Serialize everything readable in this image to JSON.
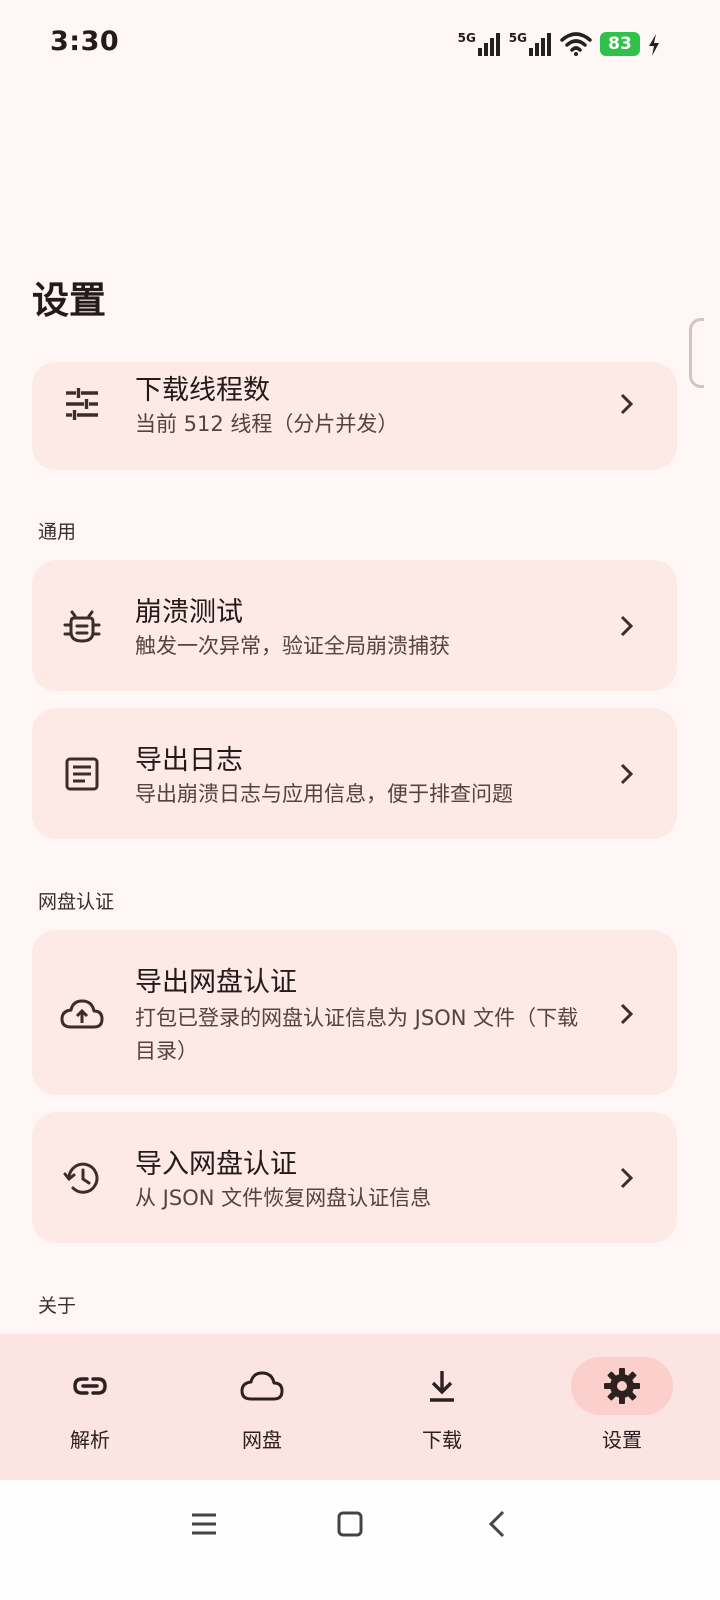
{
  "status_bar": {
    "time": "3:30",
    "signal1_label": "5G",
    "signal2_label": "5G",
    "battery_level": "83",
    "battery_color": "#2fc14b"
  },
  "page": {
    "title": "设置"
  },
  "cards": {
    "threads": {
      "title": "下载线程数",
      "subtitle": "当前 512 线程（分片并发）",
      "icon": "tune-icon"
    },
    "crash_test": {
      "title": "崩溃测试",
      "subtitle": "触发一次异常，验证全局崩溃捕获",
      "icon": "bug-icon"
    },
    "export_log": {
      "title": "导出日志",
      "subtitle": "导出崩溃日志与应用信息，便于排查问题",
      "icon": "document-icon"
    },
    "export_auth": {
      "title": "导出网盘认证",
      "subtitle": "打包已登录的网盘认证信息为 JSON 文件（下载目录）",
      "icon": "cloud-upload-icon"
    },
    "import_auth": {
      "title": "导入网盘认证",
      "subtitle": "从 JSON 文件恢复网盘认证信息",
      "icon": "history-icon"
    }
  },
  "sections": {
    "general": "通用",
    "auth": "网盘认证",
    "about": "关于"
  },
  "bottom_nav": {
    "items": [
      {
        "label": "解析",
        "icon": "link-icon",
        "active": false
      },
      {
        "label": "网盘",
        "icon": "cloud-icon",
        "active": false
      },
      {
        "label": "下载",
        "icon": "download-icon",
        "active": false
      },
      {
        "label": "设置",
        "icon": "gear-icon",
        "active": true
      }
    ],
    "active_color": "#fbcfcb"
  },
  "colors": {
    "background": "#fef7f5",
    "card": "#fde9e6",
    "accent": "#fbcfcb"
  }
}
